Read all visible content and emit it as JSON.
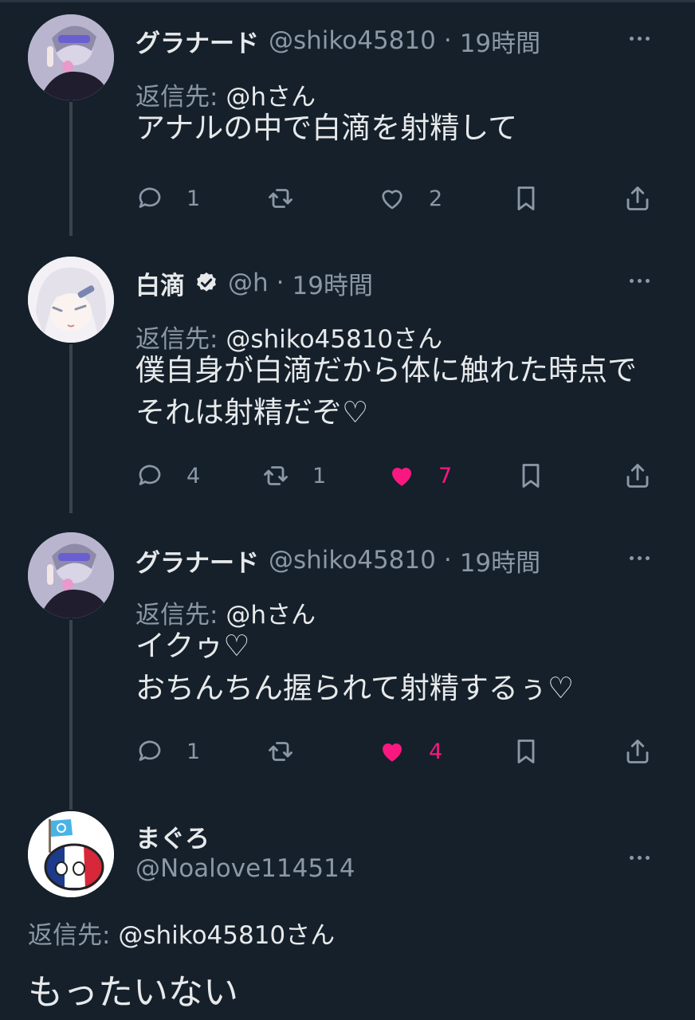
{
  "tweets": [
    {
      "name": "グラナード",
      "handle": "@shiko45810",
      "dot": "·",
      "time": "19時間",
      "reply_prefix": "返信先:",
      "reply_to": "@hさん",
      "lines": [
        "アナルの中で白滴を射精して"
      ],
      "replies": "1",
      "retweets": "",
      "likes": "2",
      "liked": false
    },
    {
      "name": "白滴",
      "verified": true,
      "handle": "@h",
      "dot": "·",
      "time": "19時間",
      "reply_prefix": "返信先:",
      "reply_to": "@shiko45810さん",
      "lines": [
        "僕自身が白滴だから体に触れた時点で",
        "それは射精だぞ♡"
      ],
      "replies": "4",
      "retweets": "1",
      "likes": "7",
      "liked": true
    },
    {
      "name": "グラナード",
      "handle": "@shiko45810",
      "dot": "·",
      "time": "19時間",
      "reply_prefix": "返信先:",
      "reply_to": "@hさん",
      "lines": [
        "イクゥ♡",
        "おちんちん握られて射精するぅ♡"
      ],
      "replies": "1",
      "retweets": "",
      "likes": "4",
      "liked": true
    }
  ],
  "focused": {
    "name": "まぐろ",
    "handle": "@Noalove114514",
    "reply_prefix": "返信先:",
    "reply_to": "@shiko45810さん",
    "text": "もったいない"
  },
  "colors": {
    "background": "#15202b",
    "text": "#e7e9ea",
    "secondary": "#8b98a5",
    "like": "#f91880",
    "thread_line": "#38444d"
  }
}
